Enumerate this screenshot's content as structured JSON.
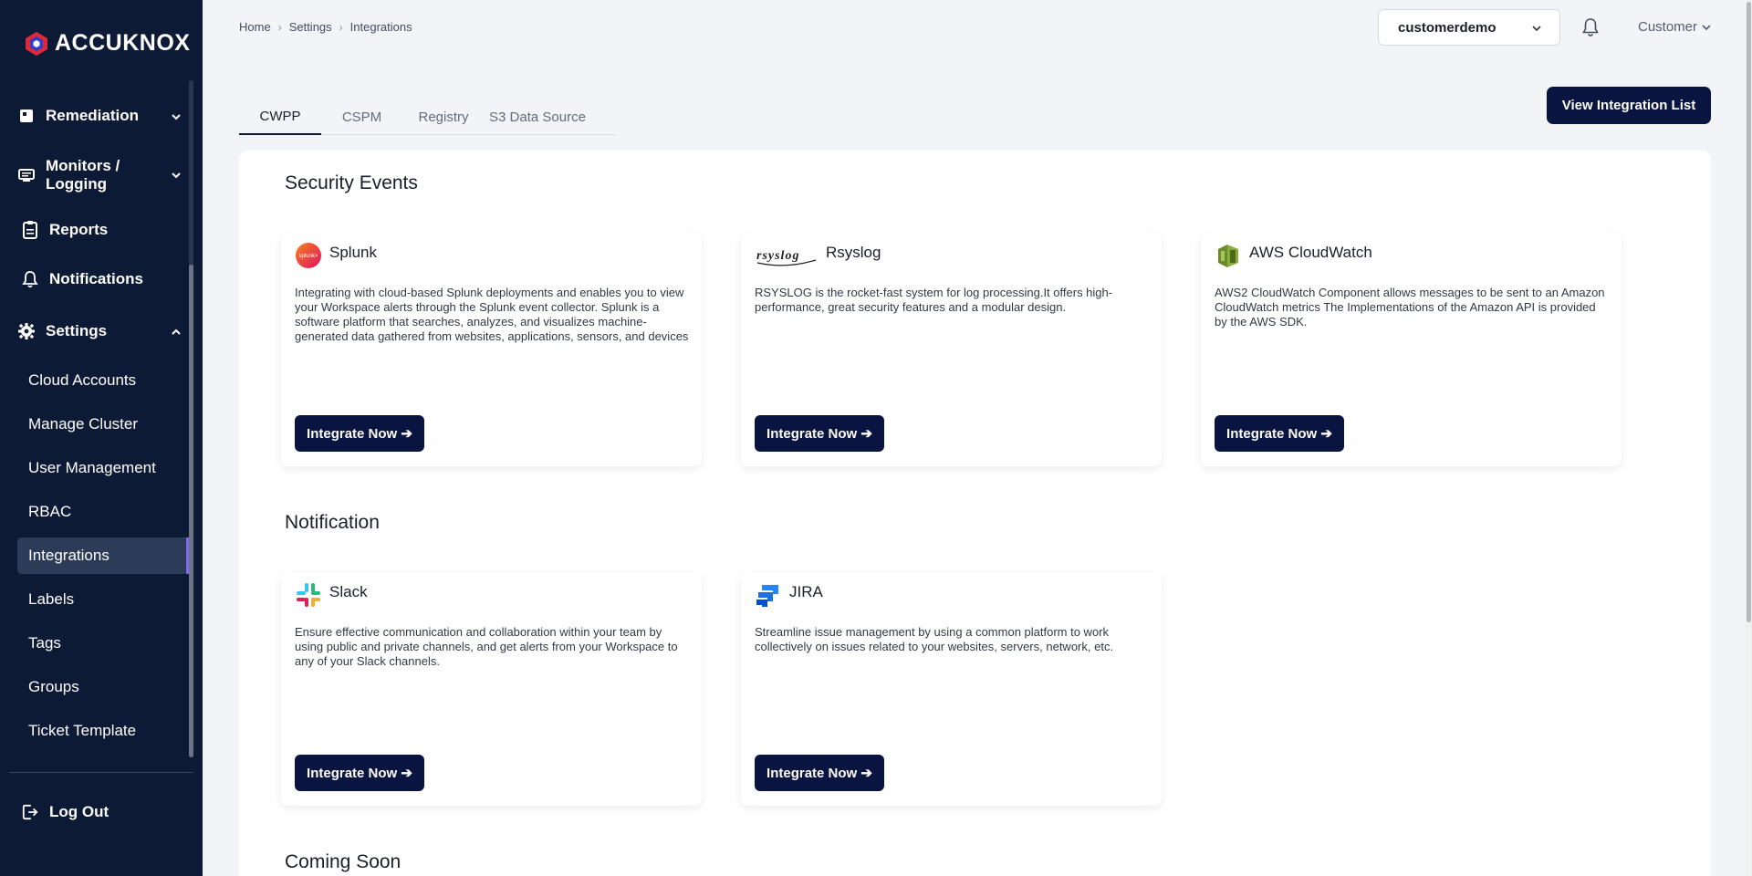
{
  "app": {
    "logo_text": "AccuKnox"
  },
  "sidebar": {
    "items": [
      {
        "label": "Remediation",
        "icon": "remediation-icon"
      },
      {
        "label": "Monitors / Logging",
        "icon": "monitor-icon"
      },
      {
        "label": "Reports",
        "icon": "reports-icon"
      },
      {
        "label": "Notifications",
        "icon": "bell-icon"
      },
      {
        "label": "Settings",
        "icon": "gear-icon"
      }
    ],
    "settings_sub": [
      "Cloud Accounts",
      "Manage Cluster",
      "User Management",
      "RBAC",
      "Integrations",
      "Labels",
      "Tags",
      "Groups",
      "Ticket Template"
    ],
    "active_sub": "Integrations",
    "logout_label": "Log Out"
  },
  "breadcrumb": [
    "Home",
    "Settings",
    "Integrations"
  ],
  "header": {
    "tenant": "customerdemo",
    "user": "Customer"
  },
  "tabs": [
    "CWPP",
    "CSPM",
    "Registry",
    "S3 Data Source"
  ],
  "active_tab": "CWPP",
  "view_list_label": "View Integration List",
  "sections": [
    {
      "title": "Security Events",
      "cards": [
        {
          "name": "Splunk",
          "desc": "Integrating with cloud-based Splunk deployments and enables you to view your Workspace alerts through the Splunk event collector. Splunk is a software platform that searches, analyzes, and visualizes machine-generated data gathered from websites, applications, sensors, and devices",
          "button": "Integrate Now ➔",
          "icon": "splunk-icon"
        },
        {
          "name": "Rsyslog",
          "desc": "RSYSLOG is the rocket-fast system for log processing.It offers high-performance, great security features and a modular design.",
          "button": "Integrate Now ➔",
          "icon": "rsyslog-icon"
        },
        {
          "name": "AWS CloudWatch",
          "desc": "AWS2 CloudWatch Component allows messages to be sent to an Amazon CloudWatch metrics The Implementations of the Amazon API is provided by the AWS SDK.",
          "button": "Integrate Now ➔",
          "icon": "aws-cloudwatch-icon"
        }
      ]
    },
    {
      "title": "Notification",
      "cards": [
        {
          "name": "Slack",
          "desc": "Ensure effective communication and collaboration within your team by using public and private channels, and get alerts from your Workspace to any of your Slack channels.",
          "button": "Integrate Now ➔",
          "icon": "slack-icon"
        },
        {
          "name": "JIRA",
          "desc": "Streamline issue management by using a common platform to work collectively on issues related to your websites, servers, network, etc.",
          "button": "Integrate Now ➔",
          "icon": "jira-icon"
        }
      ]
    },
    {
      "title": "Coming Soon",
      "cards": []
    }
  ],
  "logo_texts": {
    "splunk": "splunk>",
    "rsyslog": "rsyslog"
  },
  "colors": {
    "sidebar_bg": "#0d1a35",
    "primary_button": "#0a1440",
    "active_indicator": "#7b6cf0"
  }
}
